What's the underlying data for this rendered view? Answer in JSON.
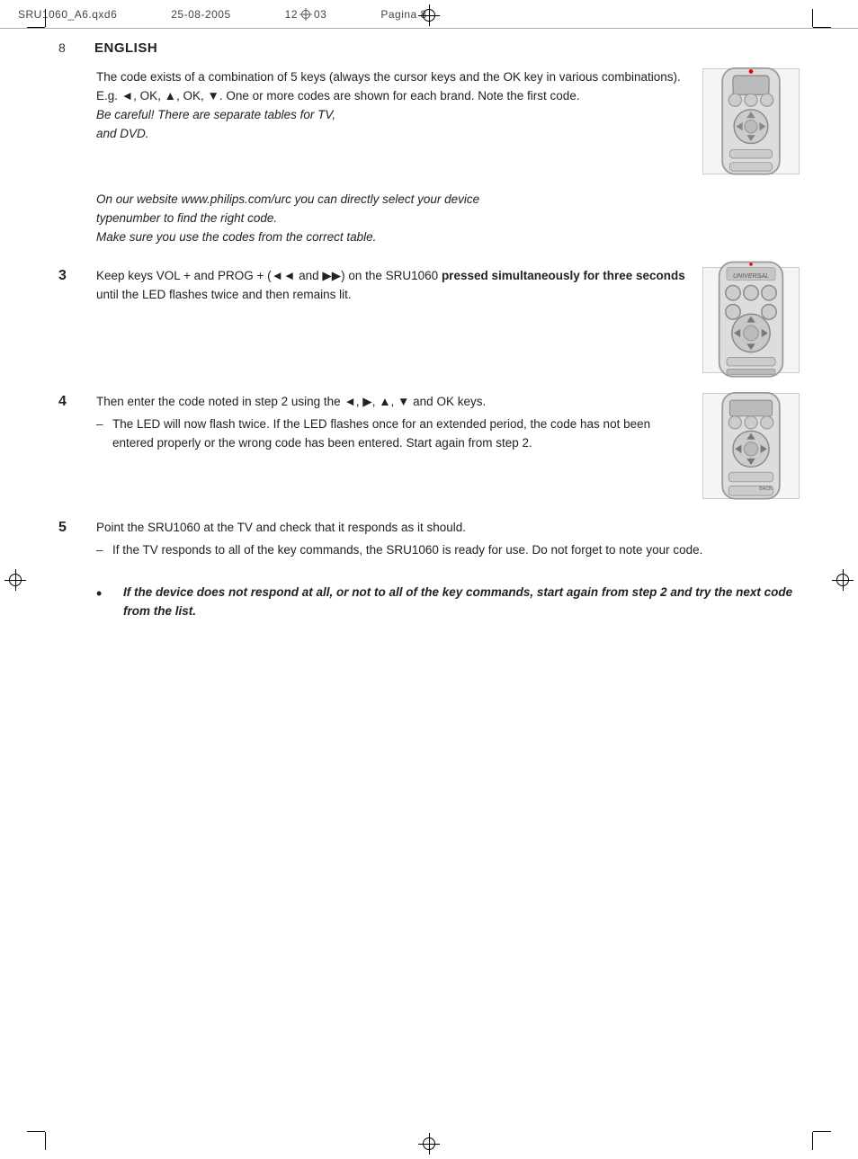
{
  "header": {
    "filename": "SRU1060_A6.qxd6",
    "date": "25-08-2005",
    "time": "12:03",
    "page_label": "Pagina 8"
  },
  "page_number": "8",
  "section": {
    "title": "ENGLISH"
  },
  "intro": {
    "paragraph1": "The code exists of a combination of 5 keys (always the cursor keys and the OK key in various combinations). E.g. ◄, OK, ▲, OK, ▼. One or more codes are shown for each brand. Note the first code.",
    "italic1": "Be careful! There are separate tables for TV,",
    "italic2": "and DVD."
  },
  "website": {
    "line1": "On our website www.philips.com/urc you can directly select your device",
    "line2": "typenumber to find the right code.",
    "line3": "Make sure you use the codes from the correct table."
  },
  "steps": [
    {
      "number": "3",
      "text_before_bold": "Keep keys VOL + and PROG + (◄◄ and ▶▶) on the SRU1060 ",
      "bold_text": "pressed simultaneously for three seconds",
      "text_after_bold": " until the LED flashes twice and then remains lit."
    },
    {
      "number": "4",
      "line1_before": "Then enter the code noted in step 2 using the ◄, ▶, ▲, ▼ and OK keys.",
      "dash_line1": "The LED will now flash twice. If the LED flashes once for an extended period, the code has not been entered properly or the wrong code has been entered. Start again from step 2."
    },
    {
      "number": "5",
      "line1": "Point the SRU1060 at the TV and check that it responds as it should.",
      "dash_line1": "If the TV responds to all of the key commands, the SRU1060 is ready for use. Do not forget to note your code."
    }
  ],
  "bullet": {
    "symbol": "•",
    "text": "If the device does not respond at all, or not to all of the key commands, start again from step 2 and try the next code from the list."
  }
}
